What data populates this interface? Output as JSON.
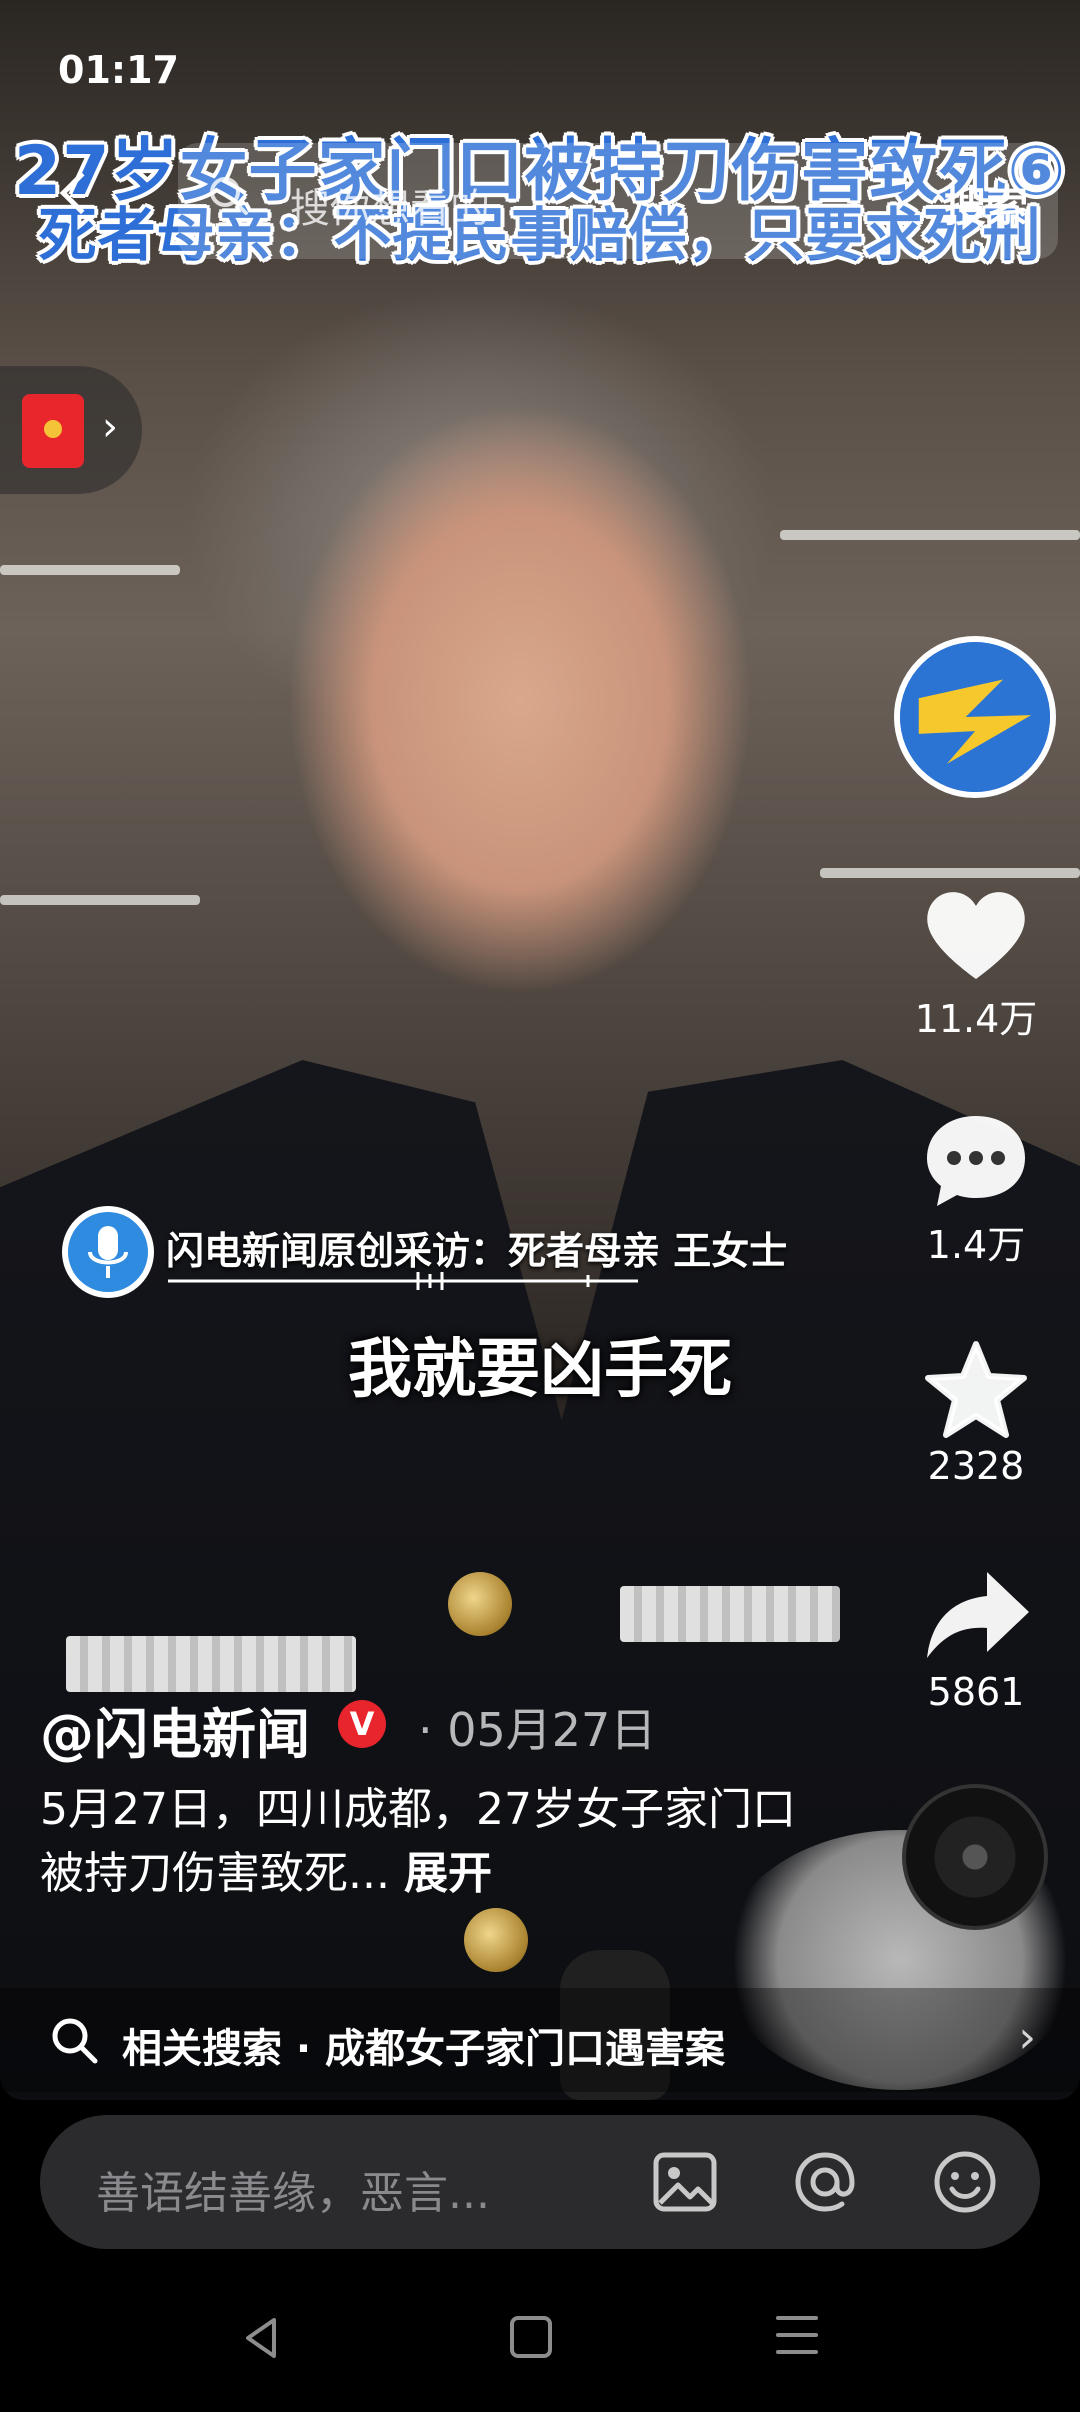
{
  "status_bar": {
    "time": "01:17"
  },
  "top_bar": {
    "search_placeholder": "搜你想看的",
    "search_button": "搜索"
  },
  "video": {
    "title_line1": "27岁女子家门口被持刀伤害致死⑥",
    "title_line2": "死者母亲：不提民事赔偿，只要求死刑",
    "interview_label": "闪电新闻原创采访：死者母亲 王女士",
    "subtitle": "我就要凶手死"
  },
  "rail": {
    "likes": "11.4万",
    "comments": "1.4万",
    "favorites": "2328",
    "shares": "5861"
  },
  "post": {
    "author": "@闪电新闻",
    "verified_badge": "V",
    "date": "· 05月27日",
    "caption": "5月27日，四川成都，27岁女子家门口被持刀伤害致死...",
    "expand": "展开"
  },
  "related_search": {
    "text": "相关搜索 · 成都女子家门口遇害案"
  },
  "comment_bar": {
    "placeholder": "善语结善缘，恶言..."
  },
  "colors": {
    "title_blue": "#2d6fd6",
    "verified_red": "#e8242c",
    "redpacket_red": "#e8262b"
  },
  "icons": [
    "back-icon",
    "search-icon",
    "redpacket-icon",
    "heart-icon",
    "comment-icon",
    "star-icon",
    "share-icon",
    "music-disc-icon",
    "image-icon",
    "at-icon",
    "emoji-icon"
  ]
}
